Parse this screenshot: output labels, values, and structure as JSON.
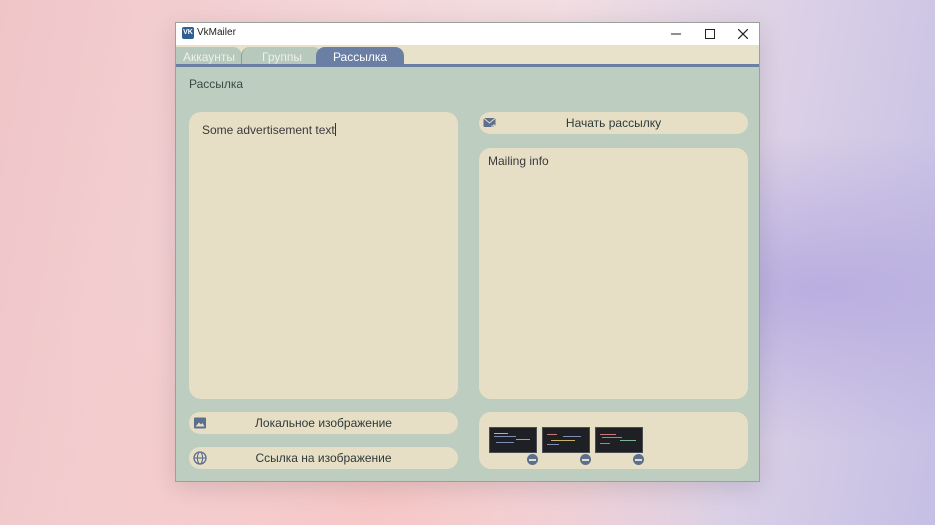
{
  "window": {
    "title": "VkMailer",
    "logo_text": "VK"
  },
  "tabs": [
    {
      "label": "Аккаунты"
    },
    {
      "label": "Группы"
    },
    {
      "label": "Рассылка"
    }
  ],
  "active_tab": "Рассылка",
  "section": {
    "title": "Рассылка"
  },
  "message": {
    "text": "Some advertisement text"
  },
  "buttons": {
    "start": "Начать рассылку",
    "local_image": "Локальное изображение",
    "image_link": "Ссылка на изображение"
  },
  "mailing_info": {
    "text": "Mailing info"
  },
  "attachments": [
    {
      "name": "screenshot-thumbnail-1"
    },
    {
      "name": "screenshot-thumbnail-2"
    },
    {
      "name": "screenshot-thumbnail-3"
    }
  ],
  "colors": {
    "accent": "#6b7ea3",
    "panel": "#e6dfc6",
    "window_bg": "#bdcdbf"
  }
}
